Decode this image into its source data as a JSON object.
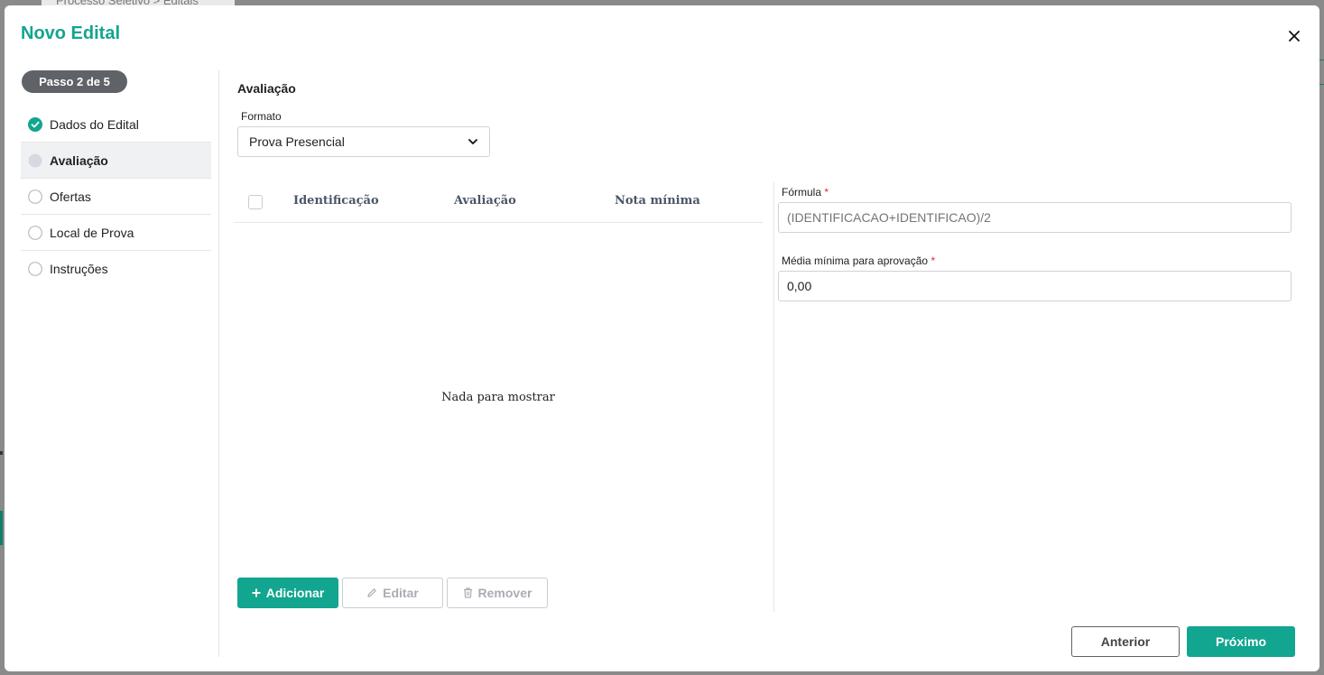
{
  "background": {
    "breadcrumb": "Processo Seletivo  >  Editais"
  },
  "modal": {
    "title": "Novo Edital"
  },
  "steps": {
    "badge": "Passo 2 de 5",
    "items": [
      {
        "label": "Dados do Edital",
        "state": "completed"
      },
      {
        "label": "Avaliação",
        "state": "current"
      },
      {
        "label": "Ofertas",
        "state": "pending"
      },
      {
        "label": "Local de Prova",
        "state": "pending"
      },
      {
        "label": "Instruções",
        "state": "pending"
      }
    ]
  },
  "avaliacao": {
    "section_title": "Avaliação",
    "formato_label": "Formato",
    "formato_value": "Prova Presencial"
  },
  "table": {
    "columns": [
      "Identificação",
      "Avaliação",
      "Nota mínima"
    ],
    "rows": [],
    "empty_text": "Nada para mostrar"
  },
  "actions": {
    "add": "Adicionar",
    "edit": "Editar",
    "remove": "Remover"
  },
  "formula": {
    "label": "Fórmula",
    "required_mark": "*",
    "placeholder": "(IDENTIFICACAO+IDENTIFICAO)/2",
    "value": ""
  },
  "media": {
    "label": "Média mínima para aprovação",
    "required_mark": "*",
    "value": "0,00"
  },
  "footer": {
    "previous": "Anterior",
    "next": "Próximo"
  },
  "colors": {
    "accent": "#12a58f",
    "badge_bg": "#5f6368",
    "required": "#d9302b"
  }
}
